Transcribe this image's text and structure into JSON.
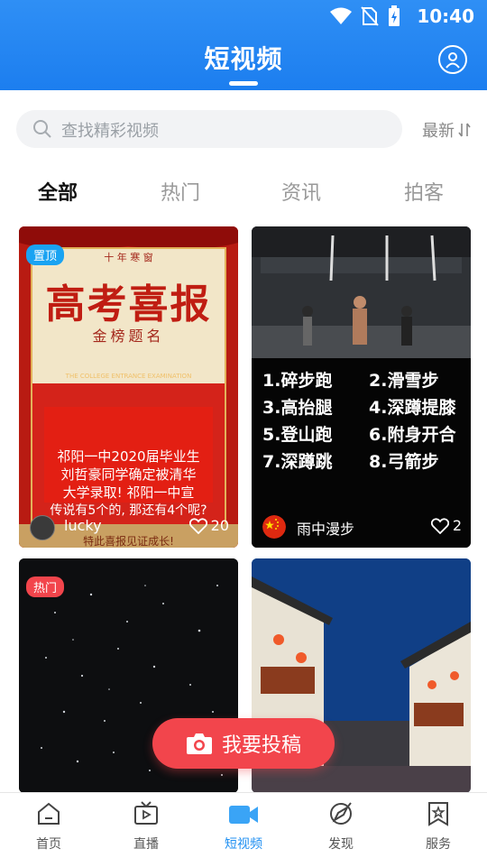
{
  "status": {
    "time": "10:40"
  },
  "header": {
    "title": "短视频"
  },
  "search": {
    "placeholder": "查找精彩视频",
    "sort_label": "最新"
  },
  "tabs": [
    {
      "label": "全部",
      "active": true
    },
    {
      "label": "热门",
      "active": false
    },
    {
      "label": "资讯",
      "active": false
    },
    {
      "label": "拍客",
      "active": false
    }
  ],
  "cards": [
    {
      "badge": "置顶",
      "badge_color": "#1aa3f2",
      "author": "lucky",
      "likes": "20",
      "poster": {
        "top_line": "十 年 寒 窗",
        "headline": "高考喜报",
        "subhead": "金榜题名",
        "en_line": "THE COLLEGE ENTRANCE EXAMINATION",
        "line1": "祁阳一中2020届毕业生",
        "line2": "刘哲豪同学确定被清华",
        "line3": "大学录取! 祁阳一中宣",
        "line4": "传说有5个的, 那还有4个呢?",
        "footer": "特此喜报见证成长!"
      }
    },
    {
      "badge": "",
      "author": "雨中漫步",
      "likes": "2",
      "moves": [
        "1.碎步跑",
        "2.滑雪步",
        "3.高抬腿",
        "4.深蹲提膝",
        "5.登山跑",
        "6.附身开合",
        "7.深蹲跳",
        "8.弓箭步"
      ]
    },
    {
      "badge": "热门",
      "badge_color": "#f2454c"
    },
    {
      "badge": ""
    }
  ],
  "fab": {
    "label": "我要投稿"
  },
  "bottom_nav": [
    {
      "label": "首页",
      "icon": "home-icon",
      "active": false
    },
    {
      "label": "直播",
      "icon": "tv-icon",
      "active": false
    },
    {
      "label": "短视频",
      "icon": "video-camera-icon",
      "active": true
    },
    {
      "label": "发现",
      "icon": "compass-icon",
      "active": false
    },
    {
      "label": "服务",
      "icon": "bookmark-star-icon",
      "active": false
    }
  ],
  "colors": {
    "primary": "#1f8ff1",
    "accent": "#f2454c"
  }
}
